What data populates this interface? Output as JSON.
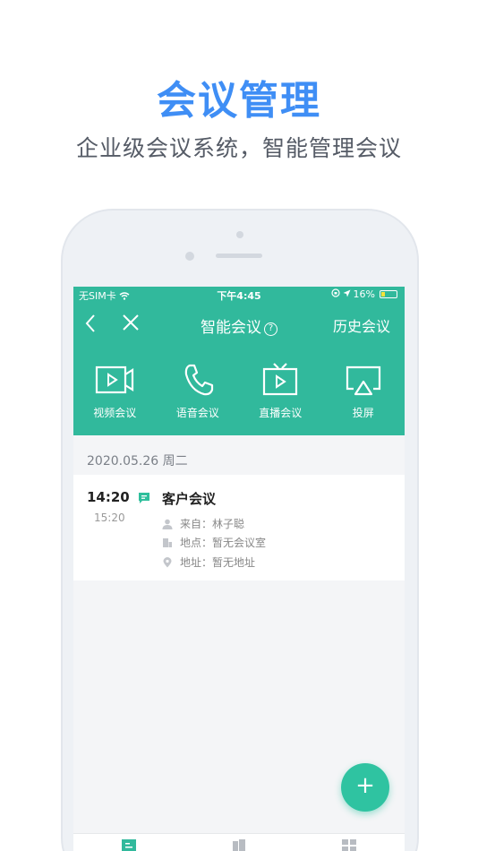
{
  "promo": {
    "title": "会议管理",
    "subtitle": "企业级会议系统，智能管理会议"
  },
  "status_bar": {
    "carrier": "无SIM卡",
    "time": "下午4:45",
    "battery": "16%"
  },
  "nav": {
    "back_icon": "chevron-left-icon",
    "close_icon": "close-icon",
    "title": "智能会议",
    "help_icon": "help-circle-icon",
    "history_label": "历史会议"
  },
  "features": [
    {
      "icon": "video-call-icon",
      "label": "视频会议"
    },
    {
      "icon": "phone-icon",
      "label": "语音会议"
    },
    {
      "icon": "tv-play-icon",
      "label": "直播会议"
    },
    {
      "icon": "airplay-icon",
      "label": "投屏"
    }
  ],
  "date_header": "2020.05.26 周二",
  "meeting": {
    "start_time": "14:20",
    "end_time": "15:20",
    "title": "客户会议",
    "from": "来自：林子聪",
    "venue": "地点：暂无会议室",
    "address": "地址：暂无地址"
  },
  "fab_label": "+",
  "colors": {
    "brand": "#31b99c",
    "promo_title": "#3f8ef5",
    "fab": "#2fc3a1"
  }
}
